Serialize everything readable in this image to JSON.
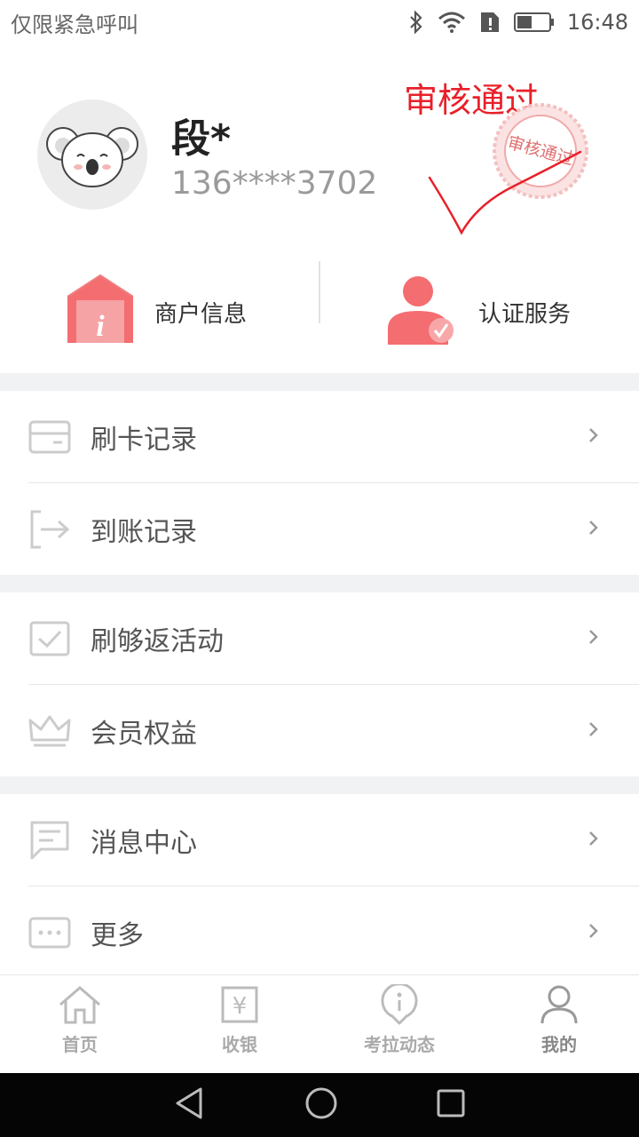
{
  "status_bar": {
    "carrier_text": "仅限紧急呼叫",
    "time": "16:48",
    "icons": [
      "bluetooth-icon",
      "wifi-icon",
      "sim-alert-icon",
      "battery-icon"
    ]
  },
  "profile": {
    "avatar_icon": "koala-avatar-icon",
    "name": "段*",
    "phone": "136****3702"
  },
  "annotation": {
    "handwritten_text": "审核通过",
    "stamp_text": "审核通过",
    "color": "#e8202a"
  },
  "quick_actions": [
    {
      "label": "商户信息",
      "icon": "merchant-info-icon"
    },
    {
      "label": "认证服务",
      "icon": "certify-user-icon"
    }
  ],
  "menu_groups": [
    [
      {
        "label": "刷卡记录",
        "icon": "card-icon"
      },
      {
        "label": "到账记录",
        "icon": "exit-arrow-icon"
      }
    ],
    [
      {
        "label": "刷够返活动",
        "icon": "check-box-icon"
      },
      {
        "label": "会员权益",
        "icon": "crown-icon"
      }
    ],
    [
      {
        "label": "消息中心",
        "icon": "message-icon"
      },
      {
        "label": "更多",
        "icon": "more-dots-icon"
      }
    ]
  ],
  "tab_bar": [
    {
      "label": "首页",
      "icon": "home-icon",
      "active": false
    },
    {
      "label": "收银",
      "icon": "cashier-icon",
      "active": false
    },
    {
      "label": "考拉动态",
      "icon": "info-pin-icon",
      "active": false
    },
    {
      "label": "我的",
      "icon": "user-icon",
      "active": true
    }
  ],
  "colors": {
    "accent_red": "#f0666b",
    "divider_gray": "#f1f2f4"
  }
}
